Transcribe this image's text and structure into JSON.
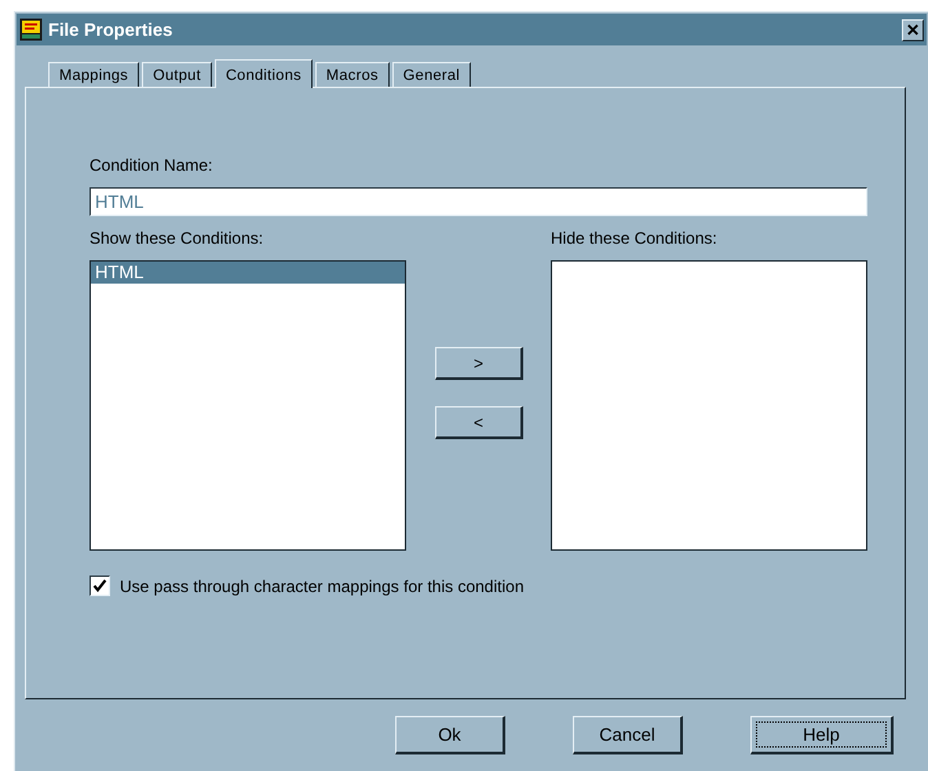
{
  "window": {
    "title": "File Properties",
    "close_glyph": "✕"
  },
  "tabs": [
    {
      "label": "Mappings",
      "selected": false
    },
    {
      "label": "Output",
      "selected": false
    },
    {
      "label": "Conditions",
      "selected": true
    },
    {
      "label": "Macros",
      "selected": false
    },
    {
      "label": "General",
      "selected": false
    }
  ],
  "condition_name": {
    "label": "Condition Name:",
    "value": "HTML"
  },
  "show_list": {
    "label": "Show these Conditions:",
    "items": [
      {
        "text": "HTML",
        "selected": true
      }
    ]
  },
  "hide_list": {
    "label": "Hide these Conditions:"
  },
  "move_buttons": [
    ">",
    "<"
  ],
  "pass_through": {
    "label": "Use pass through character mappings for this condition",
    "checked": true
  },
  "buttons": [
    {
      "label": "Ok",
      "focused": false
    },
    {
      "label": "Cancel",
      "focused": false
    },
    {
      "label": "Help",
      "focused": true
    }
  ]
}
